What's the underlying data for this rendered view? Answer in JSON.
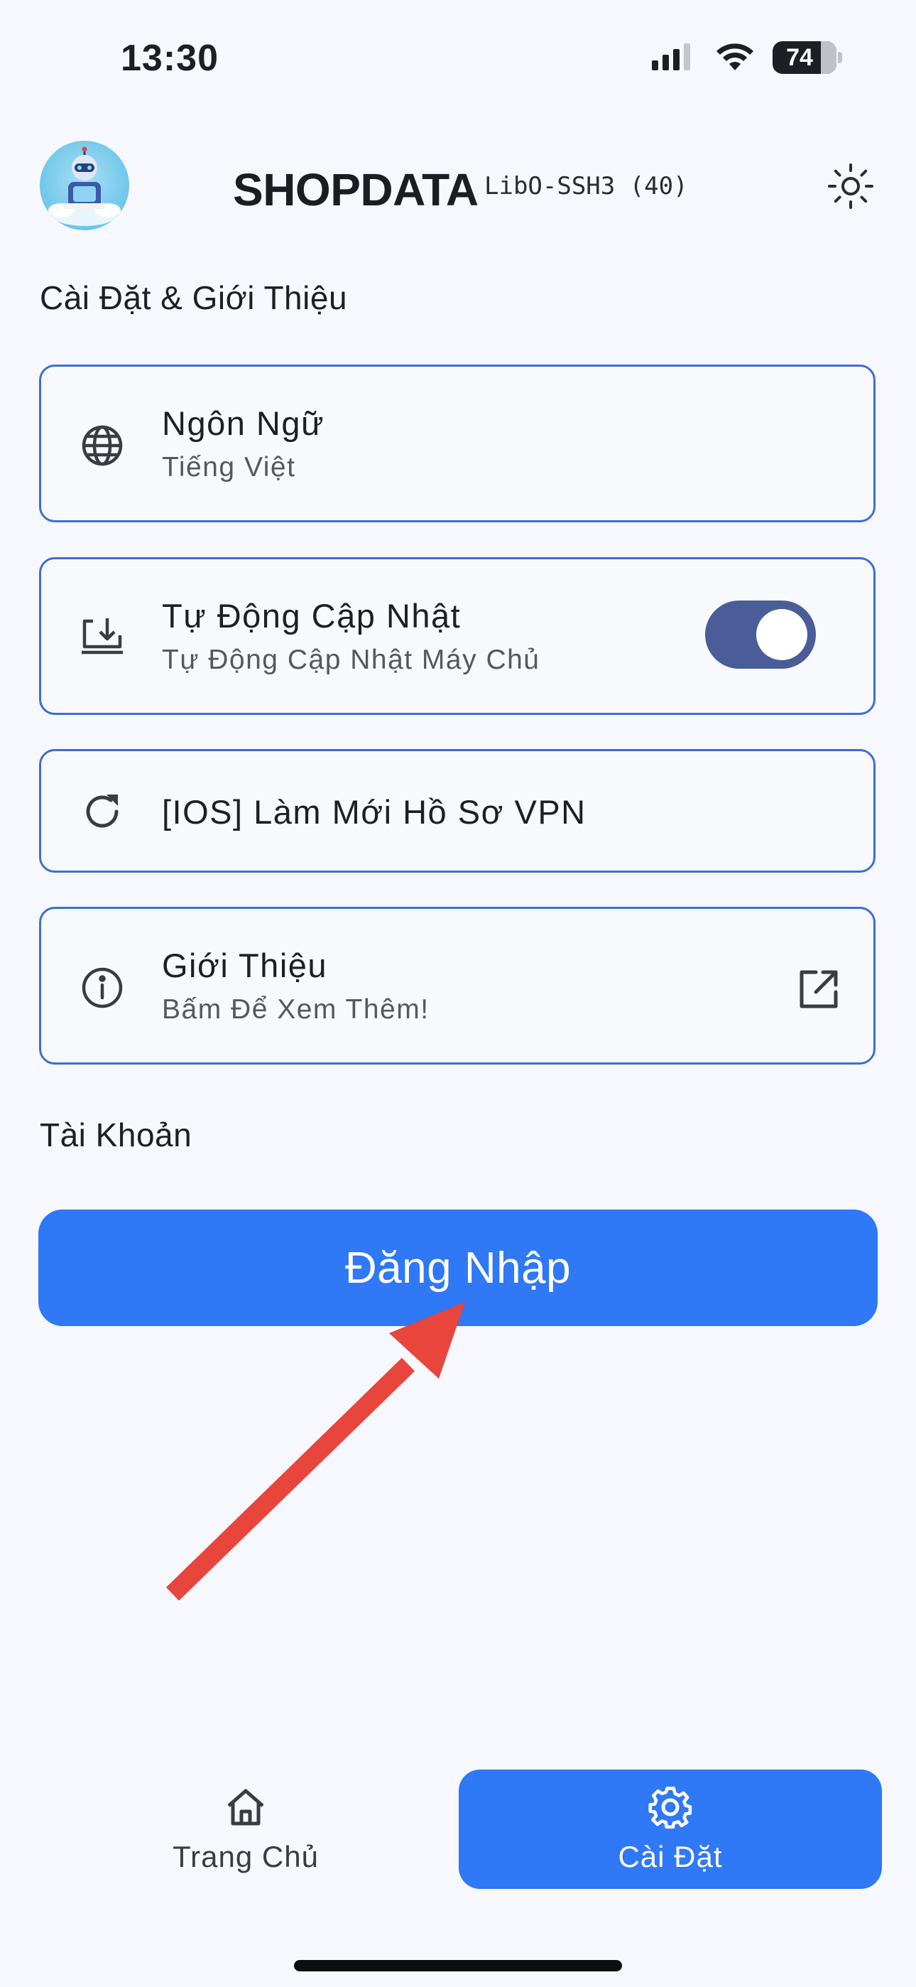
{
  "status_bar": {
    "time": "13:30",
    "battery": "74",
    "icons": [
      "signal-icon",
      "wifi-icon",
      "battery-icon"
    ]
  },
  "header": {
    "title": "SHOPDATA",
    "version": "LibO-SSH3 (40)",
    "theme_icon": "sun-icon"
  },
  "sections": {
    "settings_heading": "Cài Đặt & Giới Thiệu",
    "account_heading": "Tài Khoản"
  },
  "settings": {
    "language": {
      "icon": "globe-icon",
      "title": "Ngôn Ngữ",
      "subtitle": "Tiếng Việt"
    },
    "auto_update": {
      "icon": "download-monitor-icon",
      "title": "Tự Động Cập Nhật",
      "subtitle": "Tự Động Cập Nhật Máy Chủ",
      "enabled": true
    },
    "refresh_vpn": {
      "icon": "refresh-icon",
      "title": "[IOS] Làm Mới Hồ Sơ VPN"
    },
    "about": {
      "icon": "info-icon",
      "title": "Giới Thiệu",
      "subtitle": "Bấm Để Xem Thêm!",
      "action_icon": "external-link-icon"
    }
  },
  "account": {
    "login_label": "Đăng Nhập"
  },
  "bottom_nav": {
    "items": [
      {
        "label": "Trang Chủ",
        "icon": "home-icon",
        "active": false
      },
      {
        "label": "Cài Đặt",
        "icon": "gear-icon",
        "active": true
      }
    ]
  },
  "colors": {
    "accent": "#2f78f6",
    "card_border": "#3c6fd1",
    "toggle_on": "#4a5d98",
    "background": "#f7f8fd",
    "annotation_arrow": "#e8453c"
  }
}
